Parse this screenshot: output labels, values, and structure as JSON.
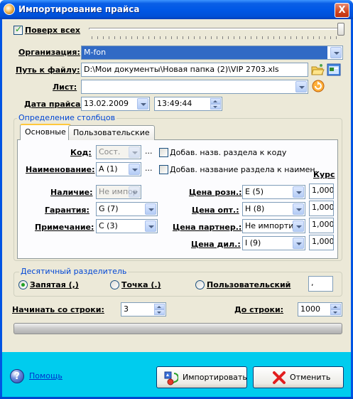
{
  "window": {
    "title": "Импортирование прайса",
    "close_glyph": "X"
  },
  "top": {
    "always_on_top_label": "Поверх всех",
    "always_on_top_checked": true
  },
  "form": {
    "org_label": "Организация:",
    "org_value": "M-fon",
    "path_label": "Путь к файлу:",
    "path_value": "D:\\Мои документы\\Новая папка (2)\\VIP 2703.xls",
    "sheet_label": "Лист:",
    "sheet_value": "",
    "date_label": "Дата прайса:",
    "date_value": "13.02.2009",
    "time_value": "13:49:44"
  },
  "columns": {
    "group_title": "Определение столбцов",
    "tabs": [
      "Основные",
      "Пользовательские"
    ],
    "code_label": "Код:",
    "code_value": "Сост.",
    "name_label": "Наименование:",
    "name_value": "A (1)",
    "ellipsis": "...",
    "add_section_code": "Добав. назв. раздела к коду",
    "add_section_name": "Добав. название раздела к наимен.",
    "rate_header": "Курс",
    "availability_label": "Наличие:",
    "availability_value": "Не импор",
    "warranty_label": "Гарантия:",
    "warranty_value": "G (7)",
    "note_label": "Примечание:",
    "note_value": "C (3)",
    "retail_label": "Цена розн.:",
    "retail_value": "E (5)",
    "retail_rate": "1,000",
    "wholesale_label": "Цена опт.:",
    "wholesale_value": "H (8)",
    "wholesale_rate": "1,000",
    "partner_label": "Цена партнер.:",
    "partner_value": "Не импортир",
    "partner_rate": "1,000",
    "dealer_label": "Цена дил.:",
    "dealer_value": "I (9)",
    "dealer_rate": "1,000"
  },
  "decimal": {
    "group_title": "Десятичный разделитель",
    "comma_label": "Запятая (,)",
    "dot_label": "Точка (.)",
    "custom_label": "Пользовательский",
    "custom_value": ",",
    "selected": "comma"
  },
  "rows": {
    "start_label": "Начинать со строки:",
    "start_value": "3",
    "end_label": "До строки:",
    "end_value": "1000"
  },
  "progress": 0,
  "footer": {
    "help_label": "Помощь",
    "import_label": "Импортировать",
    "cancel_label": "Отменить"
  },
  "colors": {
    "title_bar": "#0058e6",
    "client_bg": "#ece9d8",
    "bottom_band": "#00ccee",
    "org_selected_bg": "#316ac5"
  }
}
